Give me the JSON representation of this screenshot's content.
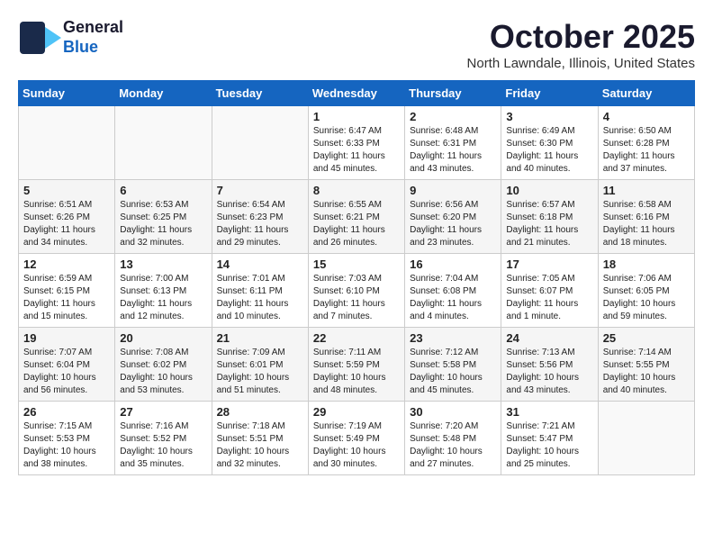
{
  "header": {
    "logo_line1": "General",
    "logo_line2": "Blue",
    "month": "October 2025",
    "location": "North Lawndale, Illinois, United States"
  },
  "weekdays": [
    "Sunday",
    "Monday",
    "Tuesday",
    "Wednesday",
    "Thursday",
    "Friday",
    "Saturday"
  ],
  "weeks": [
    [
      {
        "day": "",
        "info": ""
      },
      {
        "day": "",
        "info": ""
      },
      {
        "day": "",
        "info": ""
      },
      {
        "day": "1",
        "info": "Sunrise: 6:47 AM\nSunset: 6:33 PM\nDaylight: 11 hours\nand 45 minutes."
      },
      {
        "day": "2",
        "info": "Sunrise: 6:48 AM\nSunset: 6:31 PM\nDaylight: 11 hours\nand 43 minutes."
      },
      {
        "day": "3",
        "info": "Sunrise: 6:49 AM\nSunset: 6:30 PM\nDaylight: 11 hours\nand 40 minutes."
      },
      {
        "day": "4",
        "info": "Sunrise: 6:50 AM\nSunset: 6:28 PM\nDaylight: 11 hours\nand 37 minutes."
      }
    ],
    [
      {
        "day": "5",
        "info": "Sunrise: 6:51 AM\nSunset: 6:26 PM\nDaylight: 11 hours\nand 34 minutes."
      },
      {
        "day": "6",
        "info": "Sunrise: 6:53 AM\nSunset: 6:25 PM\nDaylight: 11 hours\nand 32 minutes."
      },
      {
        "day": "7",
        "info": "Sunrise: 6:54 AM\nSunset: 6:23 PM\nDaylight: 11 hours\nand 29 minutes."
      },
      {
        "day": "8",
        "info": "Sunrise: 6:55 AM\nSunset: 6:21 PM\nDaylight: 11 hours\nand 26 minutes."
      },
      {
        "day": "9",
        "info": "Sunrise: 6:56 AM\nSunset: 6:20 PM\nDaylight: 11 hours\nand 23 minutes."
      },
      {
        "day": "10",
        "info": "Sunrise: 6:57 AM\nSunset: 6:18 PM\nDaylight: 11 hours\nand 21 minutes."
      },
      {
        "day": "11",
        "info": "Sunrise: 6:58 AM\nSunset: 6:16 PM\nDaylight: 11 hours\nand 18 minutes."
      }
    ],
    [
      {
        "day": "12",
        "info": "Sunrise: 6:59 AM\nSunset: 6:15 PM\nDaylight: 11 hours\nand 15 minutes."
      },
      {
        "day": "13",
        "info": "Sunrise: 7:00 AM\nSunset: 6:13 PM\nDaylight: 11 hours\nand 12 minutes."
      },
      {
        "day": "14",
        "info": "Sunrise: 7:01 AM\nSunset: 6:11 PM\nDaylight: 11 hours\nand 10 minutes."
      },
      {
        "day": "15",
        "info": "Sunrise: 7:03 AM\nSunset: 6:10 PM\nDaylight: 11 hours\nand 7 minutes."
      },
      {
        "day": "16",
        "info": "Sunrise: 7:04 AM\nSunset: 6:08 PM\nDaylight: 11 hours\nand 4 minutes."
      },
      {
        "day": "17",
        "info": "Sunrise: 7:05 AM\nSunset: 6:07 PM\nDaylight: 11 hours\nand 1 minute."
      },
      {
        "day": "18",
        "info": "Sunrise: 7:06 AM\nSunset: 6:05 PM\nDaylight: 10 hours\nand 59 minutes."
      }
    ],
    [
      {
        "day": "19",
        "info": "Sunrise: 7:07 AM\nSunset: 6:04 PM\nDaylight: 10 hours\nand 56 minutes."
      },
      {
        "day": "20",
        "info": "Sunrise: 7:08 AM\nSunset: 6:02 PM\nDaylight: 10 hours\nand 53 minutes."
      },
      {
        "day": "21",
        "info": "Sunrise: 7:09 AM\nSunset: 6:01 PM\nDaylight: 10 hours\nand 51 minutes."
      },
      {
        "day": "22",
        "info": "Sunrise: 7:11 AM\nSunset: 5:59 PM\nDaylight: 10 hours\nand 48 minutes."
      },
      {
        "day": "23",
        "info": "Sunrise: 7:12 AM\nSunset: 5:58 PM\nDaylight: 10 hours\nand 45 minutes."
      },
      {
        "day": "24",
        "info": "Sunrise: 7:13 AM\nSunset: 5:56 PM\nDaylight: 10 hours\nand 43 minutes."
      },
      {
        "day": "25",
        "info": "Sunrise: 7:14 AM\nSunset: 5:55 PM\nDaylight: 10 hours\nand 40 minutes."
      }
    ],
    [
      {
        "day": "26",
        "info": "Sunrise: 7:15 AM\nSunset: 5:53 PM\nDaylight: 10 hours\nand 38 minutes."
      },
      {
        "day": "27",
        "info": "Sunrise: 7:16 AM\nSunset: 5:52 PM\nDaylight: 10 hours\nand 35 minutes."
      },
      {
        "day": "28",
        "info": "Sunrise: 7:18 AM\nSunset: 5:51 PM\nDaylight: 10 hours\nand 32 minutes."
      },
      {
        "day": "29",
        "info": "Sunrise: 7:19 AM\nSunset: 5:49 PM\nDaylight: 10 hours\nand 30 minutes."
      },
      {
        "day": "30",
        "info": "Sunrise: 7:20 AM\nSunset: 5:48 PM\nDaylight: 10 hours\nand 27 minutes."
      },
      {
        "day": "31",
        "info": "Sunrise: 7:21 AM\nSunset: 5:47 PM\nDaylight: 10 hours\nand 25 minutes."
      },
      {
        "day": "",
        "info": ""
      }
    ]
  ]
}
